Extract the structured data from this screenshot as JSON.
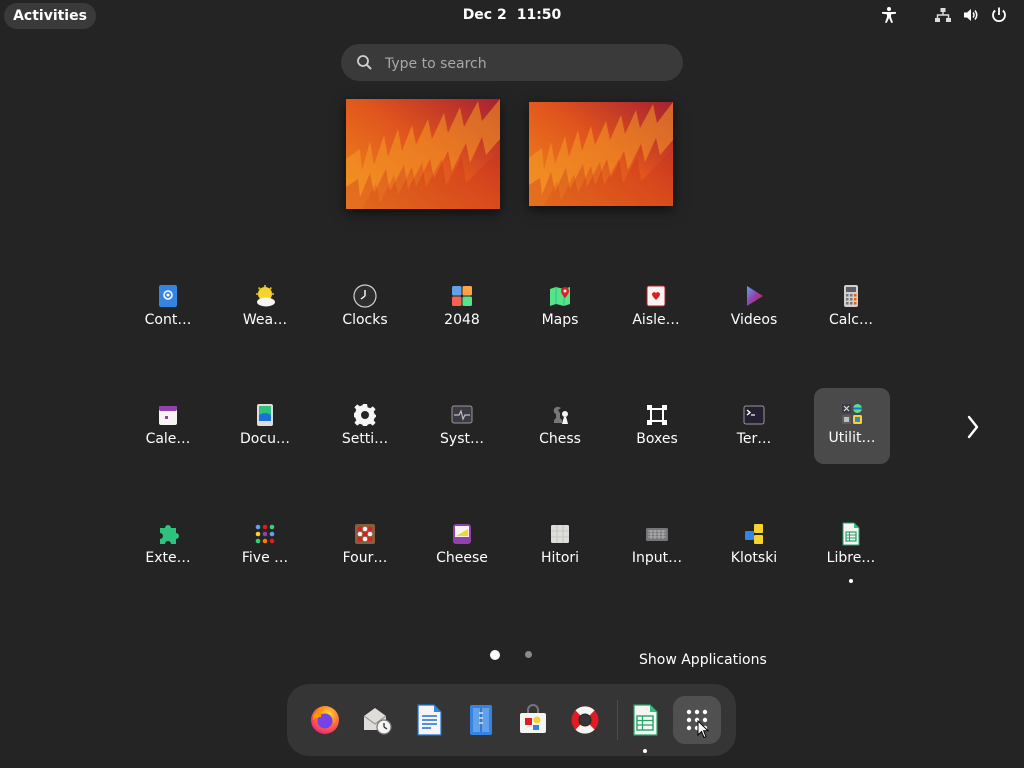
{
  "topbar": {
    "activities_label": "Activities",
    "date": "Dec 2",
    "time": "11:50",
    "tray_icons": [
      "accessibility-icon",
      "network-icon",
      "volume-icon",
      "power-icon"
    ]
  },
  "search": {
    "placeholder": "Type to search",
    "value": ""
  },
  "app_grid": {
    "rows": [
      [
        {
          "label": "Cont…",
          "icon": "contacts-icon"
        },
        {
          "label": "Wea…",
          "icon": "weather-icon"
        },
        {
          "label": "Clocks",
          "icon": "clocks-icon"
        },
        {
          "label": "2048",
          "icon": "2048-icon"
        },
        {
          "label": "Maps",
          "icon": "maps-icon"
        },
        {
          "label": "Aisle…",
          "icon": "aisleriot-icon"
        },
        {
          "label": "Videos",
          "icon": "videos-icon"
        },
        {
          "label": "Calc…",
          "icon": "calculator-icon"
        }
      ],
      [
        {
          "label": "Cale…",
          "icon": "calendar-icon"
        },
        {
          "label": "Docu…",
          "icon": "document-viewer-icon"
        },
        {
          "label": "Setti…",
          "icon": "settings-icon"
        },
        {
          "label": "Syst…",
          "icon": "system-monitor-icon"
        },
        {
          "label": "Chess",
          "icon": "chess-icon"
        },
        {
          "label": "Boxes",
          "icon": "boxes-icon"
        },
        {
          "label": "Ter…",
          "icon": "terminal-icon"
        },
        {
          "label": "Utilit…",
          "icon": "utilities-folder-icon",
          "selected": true
        }
      ],
      [
        {
          "label": "Exte…",
          "icon": "extensions-icon"
        },
        {
          "label": "Five …",
          "icon": "five-or-more-icon"
        },
        {
          "label": "Four…",
          "icon": "four-in-a-row-icon"
        },
        {
          "label": "Cheese",
          "icon": "cheese-icon"
        },
        {
          "label": "Hitori",
          "icon": "hitori-icon"
        },
        {
          "label": "Input…",
          "icon": "input-method-icon"
        },
        {
          "label": "Klotski",
          "icon": "klotski-icon"
        },
        {
          "label": "Libre…",
          "icon": "libreoffice-calc-icon",
          "running": true
        }
      ]
    ],
    "pages": 2,
    "current_page": 1
  },
  "show_apps_tooltip": "Show Applications",
  "dock": {
    "items": [
      {
        "name": "firefox",
        "icon": "firefox-icon"
      },
      {
        "name": "evolution",
        "icon": "mail-clock-icon"
      },
      {
        "name": "writer",
        "icon": "libreoffice-writer-icon"
      },
      {
        "name": "text-editor",
        "icon": "text-editor-icon"
      },
      {
        "name": "software",
        "icon": "software-bag-icon"
      },
      {
        "name": "help",
        "icon": "help-lifebuoy-icon"
      },
      {
        "name": "calc",
        "icon": "libreoffice-calc-icon",
        "running": true
      },
      {
        "name": "show-applications",
        "icon": "app-grid-icon",
        "hover": true
      }
    ]
  },
  "colors": {
    "background": "#242424",
    "panel": "#3a3a3a",
    "dock": "#353535",
    "selected": "#4a4a4a",
    "wallpaper_orange": "#e8661a",
    "wallpaper_red": "#a62031"
  }
}
